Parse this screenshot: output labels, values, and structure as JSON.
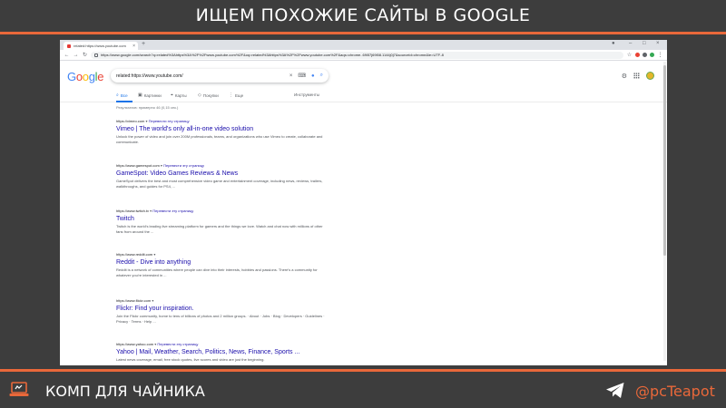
{
  "slide": {
    "title": "ИЩЕМ ПОХОЖИЕ САЙТЫ В GOOGLE",
    "brand": "КОМП ДЛЯ ЧАЙНИКА",
    "handle": "@pcTeapot",
    "accent_color": "#e9683a"
  },
  "browser": {
    "tab_title": "related:https://www.youtube.com",
    "new_tab": "+",
    "url": "https://www.google.com/search?q=related%3Ahttps%3A%2F%2Fwww.youtube.com%2F&oq=related%3Ahttps%3A%2F%2Fwww.youtube.com%2F&aqs=chrome..69i57j69i58.1144j0j7&sourceid=chrome&ie=UTF-8"
  },
  "google": {
    "logo_letters": [
      "G",
      "o",
      "o",
      "g",
      "l",
      "e"
    ],
    "query": "related:https://www.youtube.com/",
    "tabs": [
      {
        "icon": "search-icon",
        "label": "Все"
      },
      {
        "icon": "image-icon",
        "label": "Картинки"
      },
      {
        "icon": "map-pin-icon",
        "label": "Карты"
      },
      {
        "icon": "tag-icon",
        "label": "Покупки"
      },
      {
        "icon": "more-icon",
        "label": "Еще"
      }
    ],
    "tools": "Инструменты",
    "stats": "Результатов: примерно 46 (0,15 сек.)"
  },
  "results": [
    {
      "cite": "https://vimeo.com",
      "translate": "Перевести эту страницу",
      "title": "Vimeo | The world's only all-in-one video solution",
      "snippet": "Unlock the power of video and join over 200M professionals, teams, and organizations who use Vimeo to create, collaborate and communicate."
    },
    {
      "cite": "https://www.gamespot.com",
      "translate": "Перевести эту страницу",
      "title": "GameSpot: Video Games Reviews & News",
      "snippet": "GameSpot delivers the best and most comprehensive video game and entertainment coverage, including news, reviews, trailers, walkthroughs, and guides for PS4, ..."
    },
    {
      "cite": "https://www.twitch.tv",
      "translate": "Перевести эту страницу",
      "title": "Twitch",
      "snippet": "Twitch is the world's leading live streaming platform for gamers and the things we love. Watch and chat now with millions of other fans from around the ..."
    },
    {
      "cite": "https://www.reddit.com",
      "translate": "",
      "title": "Reddit - Dive into anything",
      "snippet": "Reddit is a network of communities where people can dive into their interests, hobbies and passions. There's a community for whatever you're interested in ..."
    },
    {
      "cite": "https://www.flickr.com",
      "translate": "",
      "title": "Flickr: Find your inspiration.",
      "snippet": "Join the Flickr community, home to tens of billions of photos and 2 million groups. · About · Jobs · Blog · Developers · Guidelines · Privacy · Terms · Help ..."
    },
    {
      "cite": "https://www.yahoo.com",
      "translate": "Перевести эту страницу",
      "title": "Yahoo | Mail, Weather, Search, Politics, News, Finance, Sports ...",
      "snippet": "Latest news coverage, email, free stock quotes, live scores and video are just the beginning."
    }
  ]
}
